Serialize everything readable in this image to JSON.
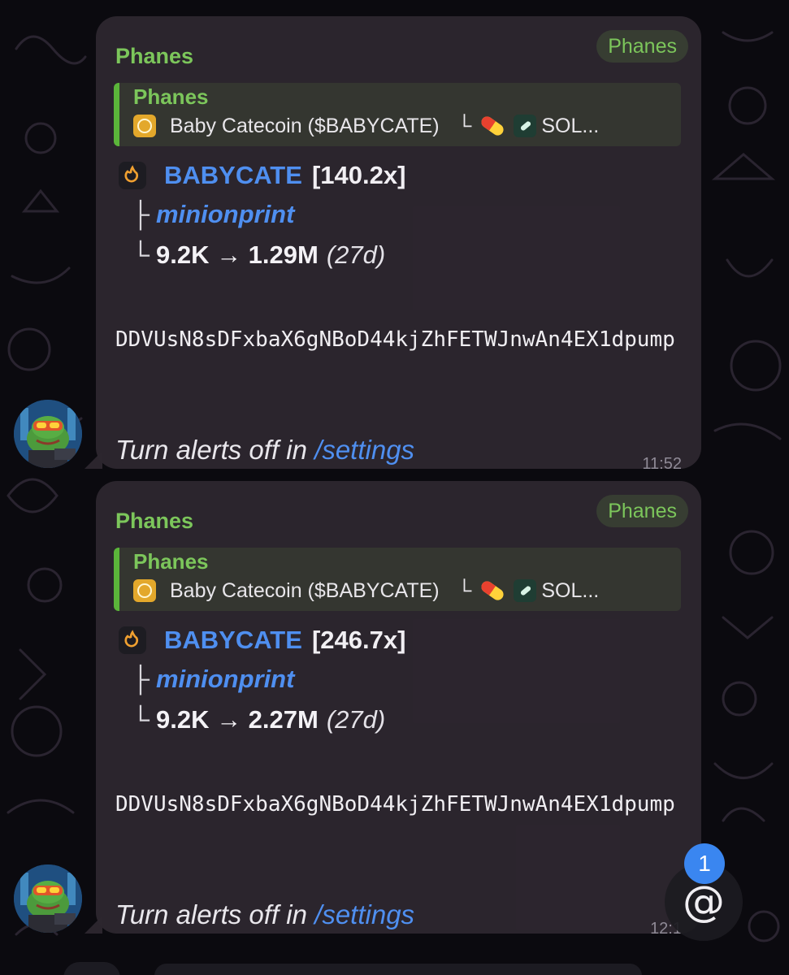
{
  "messages": [
    {
      "sender": "Phanes",
      "badge": "Phanes",
      "reply": {
        "name": "Phanes",
        "text": "Baby Catecoin ($BABYCATE)",
        "tree_char": "└",
        "chain": "SOL..."
      },
      "token": {
        "symbol": "BABYCATE",
        "multiplier": "[140.2x]"
      },
      "caller": {
        "prefix": "├",
        "name": "minionprint"
      },
      "marketcap": {
        "prefix": "└",
        "value": "9.2K → 1.29M",
        "age": "(27d)"
      },
      "address": "DDVUsN8sDFxbaX6gNBoD44kjZhFETWJnwAn4EX1dpump",
      "footer": {
        "text": "Turn alerts off in ",
        "link": "/settings"
      },
      "time": "11:52"
    },
    {
      "sender": "Phanes",
      "badge": "Phanes",
      "reply": {
        "name": "Phanes",
        "text": "Baby Catecoin ($BABYCATE)",
        "tree_char": "└",
        "chain": "SOL..."
      },
      "token": {
        "symbol": "BABYCATE",
        "multiplier": "[246.7x]"
      },
      "caller": {
        "prefix": "├",
        "name": "minionprint"
      },
      "marketcap": {
        "prefix": "└",
        "value": "9.2K → 2.27M",
        "age": "(27d)"
      },
      "address": "DDVUsN8sDFxbaX6gNBoD44kjZhFETWJnwAn4EX1dpump",
      "footer": {
        "text": "Turn alerts off in ",
        "link": "/settings"
      },
      "time": "12:1"
    }
  ],
  "mention": {
    "symbol": "@",
    "unread_count": "1"
  },
  "icons": {
    "coin": "coin-icon",
    "pill": "pill-icon",
    "sol": "sol-icon",
    "fire": "fire-icon",
    "avatar": "frog-avatar"
  },
  "colors": {
    "sender_green": "#7cc65b",
    "link_blue": "#4f8ff0",
    "bubble": "#2d262f",
    "badge_blue": "#3a86f0"
  }
}
